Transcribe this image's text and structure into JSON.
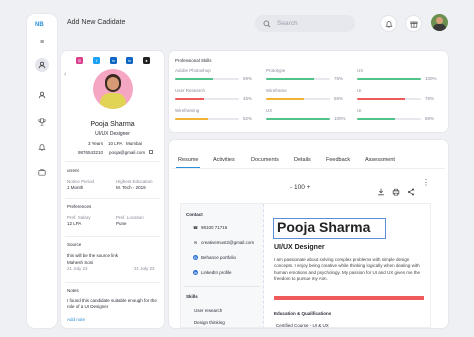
{
  "app": {
    "logo": "NB"
  },
  "header": {
    "title": "Add New Cadidate",
    "search_placeholder": "Search"
  },
  "profile": {
    "name": "Pooja Sharma",
    "role": "UI/UX Designer",
    "experience": "3 Years",
    "salary": "10 LPA",
    "city": "Mumbai",
    "phone": "9876543210",
    "email": "pooja@gmail.com"
  },
  "current": {
    "heading": "urrent",
    "notice_label": "Notice Period",
    "notice_value": "1 Month",
    "qual_label": "Highest Education",
    "qual_value": "M. Tech - 2019"
  },
  "preferences": {
    "heading": "Preferences",
    "salary_label": "Pref. Salary",
    "salary_value": "12 LPA",
    "location_label": "Pref. Location",
    "location_value": "Pune"
  },
  "source": {
    "heading": "Source",
    "text": "this will be the source link",
    "author": "Mahesh Soni",
    "date_left": "21 July 23",
    "date_right": "21 July 23"
  },
  "notes": {
    "heading": "Notes",
    "text": "I found this candidate suitable enough for the role of a UI Designer",
    "add_link": "Add note"
  },
  "skills_card": {
    "heading": "Professional Skills",
    "skills": [
      {
        "name": "Adobe Photoshop",
        "percent": 59,
        "label": "59%",
        "color": "#52c18a"
      },
      {
        "name": "Prototype",
        "percent": 75,
        "label": "75%",
        "color": "#52c18a"
      },
      {
        "name": "UX",
        "percent": 100,
        "label": "100%",
        "color": "#52c18a"
      },
      {
        "name": "User Research",
        "percent": 45,
        "label": "45%",
        "color": "#ef5a5a"
      },
      {
        "name": "Wireframe",
        "percent": 59,
        "label": "59%",
        "color": "#f2b233"
      },
      {
        "name": "UI",
        "percent": 75,
        "label": "75%",
        "color": "#ef5a5a"
      },
      {
        "name": "Wireframing",
        "percent": 52,
        "label": "52%",
        "color": "#f2b233"
      },
      {
        "name": "UX",
        "percent": 100,
        "label": "100%",
        "color": "#52c18a"
      },
      {
        "name": "UI",
        "percent": 59,
        "label": "59%",
        "color": "#52c18a"
      }
    ]
  },
  "tabs": [
    "Resume",
    "Activities",
    "Documents",
    "Details",
    "Feedback",
    "Assessment"
  ],
  "viewer": {
    "zoom": "- 100 +"
  },
  "resume": {
    "name": "Pooja Sharma",
    "title": "UI/UX Designer",
    "summary": "I am passionate about solving complex problems with simple design concepts. I enjoy being creative while thinking logically when dealing with human emotions and psychology. My passion for UI and UX gives me the freedom to pursue my Aim.",
    "contact_heading": "Contact",
    "contacts": [
      "98100 71716",
      "creativemust2@gmail.com",
      "Behance portfolio",
      "LinkedIn profile"
    ],
    "skills_heading": "Skills",
    "skills": [
      "User research",
      "Design thinking"
    ],
    "edu_heading": "Education & Qualifications",
    "edu_item": "Certified Course - UI & UX"
  }
}
